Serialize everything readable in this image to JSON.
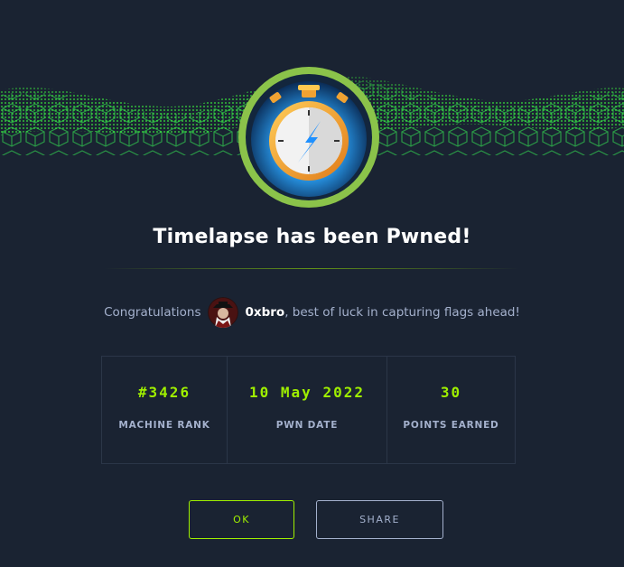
{
  "dialog": {
    "title": "Timelapse has been Pwned!",
    "congrats_prefix": "Congratulations",
    "username": "0xbro",
    "congrats_suffix": ", best of luck in capturing flags ahead!"
  },
  "stats": [
    {
      "value": "#3426",
      "label": "MACHINE RANK"
    },
    {
      "value": "10 May 2022",
      "label": "PWN DATE"
    },
    {
      "value": "30",
      "label": "POINTS EARNED"
    }
  ],
  "buttons": {
    "ok": "OK",
    "share": "SHARE"
  },
  "colors": {
    "background": "#1a2332",
    "accent": "#9fef00",
    "muted_text": "#a4b1cd",
    "border": "#2b3648"
  },
  "icons": {
    "machine": "stopwatch-icon",
    "avatar": "user-avatar"
  }
}
